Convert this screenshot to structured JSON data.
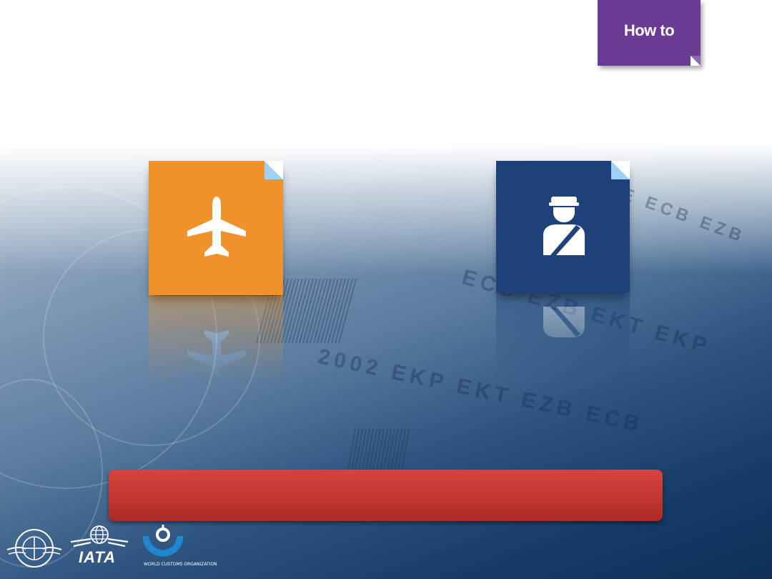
{
  "howto": {
    "label": "How to"
  },
  "tiles": [
    {
      "name": "airline",
      "icon": "airplane-icon",
      "color": "#f0922a"
    },
    {
      "name": "customs",
      "icon": "customs-officer-icon",
      "color": "#1d4178"
    }
  ],
  "banner": {
    "text": "",
    "color": "#c93a33"
  },
  "logos": {
    "icao": "ICAO emblem",
    "iata": {
      "text": "IATA"
    },
    "wco": {
      "caption": "WORLD CUSTOMS ORGANIZATION"
    }
  },
  "background": {
    "note_texts": [
      "2002 EKP EKT EZB ECB",
      "ECB EZB EKT EKP",
      "BCE ECB EZB"
    ]
  },
  "colors": {
    "howto_tab": "#6a3b92",
    "tile_fold": "#9fd2f2"
  }
}
